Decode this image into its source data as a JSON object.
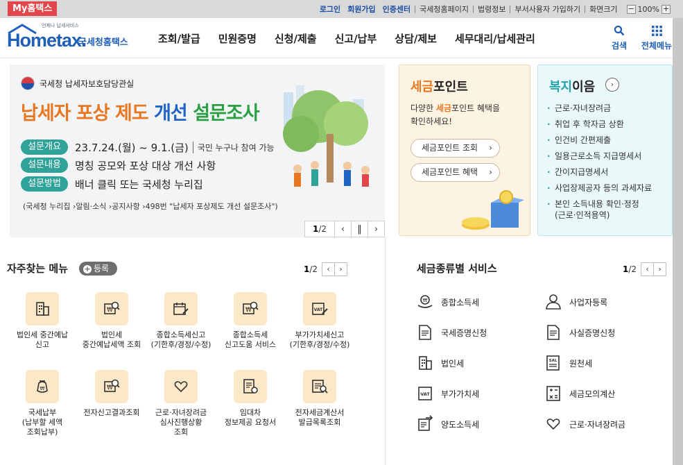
{
  "topbar": {
    "my_home": "My홈택스",
    "links": [
      {
        "label": "로그인",
        "strong": true
      },
      {
        "label": "회원가입",
        "strong": true
      },
      {
        "label": "인증센터",
        "strong": true
      },
      {
        "label": "국세청홈페이지",
        "strong": false
      },
      {
        "label": "법령정보",
        "strong": false
      },
      {
        "label": "부서사용자 가입하기",
        "strong": false
      },
      {
        "label": "화면크기",
        "strong": false
      }
    ],
    "zoom_minus": "−",
    "zoom_value": "100%",
    "zoom_plus": "+"
  },
  "header": {
    "logo_small": "언제나 납세서비스",
    "logo_word": "Hometax.",
    "logo_name": "국세청홈택스",
    "menu": [
      "조회/발급",
      "민원증명",
      "신청/제출",
      "신고/납부",
      "상담/제보",
      "세무대리/납세관리"
    ],
    "search_label": "검색",
    "allmenu_label": "전체메뉴"
  },
  "banner": {
    "org": "국세청 납세자보호담당관실",
    "title_part1": "납세자 포상 제도 ",
    "title_part2": "개선 ",
    "title_part3": "설문조사",
    "rows": [
      {
        "tag": "설문개요",
        "text": "23.7.24.(월) ~ 9.1.(금)",
        "sub": "국민 누구나 참여 가능"
      },
      {
        "tag": "설문내용",
        "text": "명칭 공모와 포상 대상 개선 사항",
        "sub": ""
      },
      {
        "tag": "설문방법",
        "text": "배너 클릭 또는 국세청 누리집",
        "sub": ""
      }
    ],
    "note": "(국세청 누리집 ›알림·소식 ›공지사항 ›498번 \"납세자 포상제도 개선 설문조사\")",
    "pager_current": "1",
    "pager_total": "/2",
    "prev": "‹",
    "pause": "‖",
    "next": "›"
  },
  "tax_point": {
    "title_hl": "세금",
    "title_rest": "포인트",
    "desc_line1_a": "다양한 ",
    "desc_line1_hl": "세금",
    "desc_line1_b": "포인트 혜택을",
    "desc_line2": "확인하세요!",
    "buttons": [
      "세금포인트 조회",
      "세금포인트 혜택"
    ],
    "chevron": "›"
  },
  "welfare": {
    "title_hl": "복지",
    "title_rest": "이음",
    "circle": "›",
    "items": [
      "근로·자녀장려금",
      "취업 후 학자금 상환",
      "인건비 간편제출",
      "일용근로소득 지급명세서",
      "간이지급명세서",
      "사업장제공자 등의 과세자료",
      "본인 소득내용 확인·정정\n(근로·인적용역)"
    ]
  },
  "favorites": {
    "title": "자주찾는 메뉴",
    "register": "등록",
    "plus": "+",
    "page_current": "1",
    "page_total": "/2",
    "prev": "‹",
    "next": "›",
    "items": [
      {
        "label": "법인세 중간예납\n신고",
        "icon": "building-icon"
      },
      {
        "label": "법인세\n중간예납세액 조회",
        "icon": "won-search-icon"
      },
      {
        "label": "종합소득세신고\n(기한후/경정/수정)",
        "icon": "calendar-edit-icon"
      },
      {
        "label": "종합소득세\n신고도움 서비스",
        "icon": "won-search-icon"
      },
      {
        "label": "부가가치세신고\n(기한후/경정/수정)",
        "icon": "vat-edit-icon"
      },
      {
        "label": "국세납부\n(납부할 세액\n조회납부)",
        "icon": "money-bag-icon"
      },
      {
        "label": "전자신고결과조회",
        "icon": "won-search-icon"
      },
      {
        "label": "근로·자녀장려금\n심사진행상황\n조회",
        "icon": "heart-hand-icon"
      },
      {
        "label": "임대차\n정보제공 요청서",
        "icon": "document-seal-icon"
      },
      {
        "label": "전자세금계산서\n발급목록조회",
        "icon": "invoice-search-icon"
      }
    ]
  },
  "tax_services": {
    "title": "세금종류별 서비스",
    "page_current": "1",
    "page_total": "/2",
    "prev": "‹",
    "next": "›",
    "items": [
      {
        "label": "종합소득세",
        "icon": "won-hand-icon"
      },
      {
        "label": "사업자등록",
        "icon": "person-icon"
      },
      {
        "label": "국세증명신청",
        "icon": "document-icon"
      },
      {
        "label": "사실증명신청",
        "icon": "document-icon"
      },
      {
        "label": "법인세",
        "icon": "building-icon"
      },
      {
        "label": "원천세",
        "icon": "salary-icon"
      },
      {
        "label": "부가가치세",
        "icon": "vat-icon"
      },
      {
        "label": "세금모의계산",
        "icon": "calculator-icon"
      },
      {
        "label": "양도소득세",
        "icon": "transfer-doc-icon"
      },
      {
        "label": "근로·자녀장려금",
        "icon": "heart-hand-icon"
      }
    ]
  },
  "colors": {
    "brand_blue": "#1f5fb5",
    "myhome_red": "#e2454a",
    "point_orange": "#e87722",
    "welfare_teal": "#22a3ad",
    "tag_teal": "#2fa39a"
  }
}
